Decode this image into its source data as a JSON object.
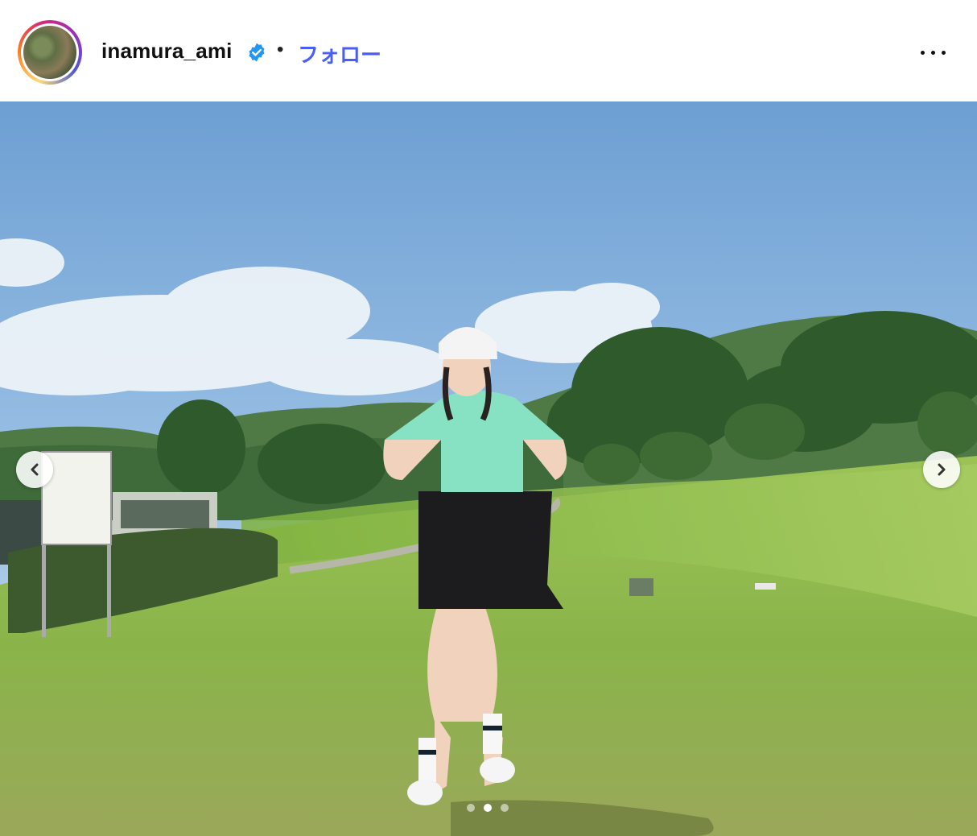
{
  "post": {
    "username": "inamura_ami",
    "separator": "•",
    "follow_label": "フォロー"
  },
  "icons": {
    "avatar": "profile-avatar",
    "verified": "verified-badge-icon",
    "more": "more-options-icon",
    "prev": "chevron-left-icon",
    "next": "chevron-right-icon"
  },
  "carousel": {
    "total": 3,
    "active_index": 1
  },
  "colors": {
    "follow": "#4a5df9",
    "verified": "#2196f3",
    "sky": "#8fb8e0",
    "grass": "#8cb84e"
  }
}
